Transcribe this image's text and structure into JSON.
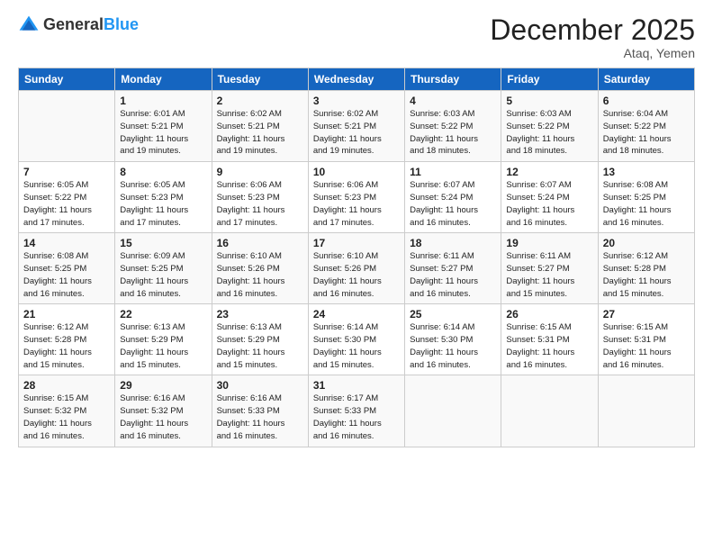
{
  "logo": {
    "general": "General",
    "blue": "Blue"
  },
  "title": "December 2025",
  "location": "Ataq, Yemen",
  "weekdays": [
    "Sunday",
    "Monday",
    "Tuesday",
    "Wednesday",
    "Thursday",
    "Friday",
    "Saturday"
  ],
  "weeks": [
    [
      {
        "num": "",
        "info": ""
      },
      {
        "num": "1",
        "info": "Sunrise: 6:01 AM\nSunset: 5:21 PM\nDaylight: 11 hours\nand 19 minutes."
      },
      {
        "num": "2",
        "info": "Sunrise: 6:02 AM\nSunset: 5:21 PM\nDaylight: 11 hours\nand 19 minutes."
      },
      {
        "num": "3",
        "info": "Sunrise: 6:02 AM\nSunset: 5:21 PM\nDaylight: 11 hours\nand 19 minutes."
      },
      {
        "num": "4",
        "info": "Sunrise: 6:03 AM\nSunset: 5:22 PM\nDaylight: 11 hours\nand 18 minutes."
      },
      {
        "num": "5",
        "info": "Sunrise: 6:03 AM\nSunset: 5:22 PM\nDaylight: 11 hours\nand 18 minutes."
      },
      {
        "num": "6",
        "info": "Sunrise: 6:04 AM\nSunset: 5:22 PM\nDaylight: 11 hours\nand 18 minutes."
      }
    ],
    [
      {
        "num": "7",
        "info": "Sunrise: 6:05 AM\nSunset: 5:22 PM\nDaylight: 11 hours\nand 17 minutes."
      },
      {
        "num": "8",
        "info": "Sunrise: 6:05 AM\nSunset: 5:23 PM\nDaylight: 11 hours\nand 17 minutes."
      },
      {
        "num": "9",
        "info": "Sunrise: 6:06 AM\nSunset: 5:23 PM\nDaylight: 11 hours\nand 17 minutes."
      },
      {
        "num": "10",
        "info": "Sunrise: 6:06 AM\nSunset: 5:23 PM\nDaylight: 11 hours\nand 17 minutes."
      },
      {
        "num": "11",
        "info": "Sunrise: 6:07 AM\nSunset: 5:24 PM\nDaylight: 11 hours\nand 16 minutes."
      },
      {
        "num": "12",
        "info": "Sunrise: 6:07 AM\nSunset: 5:24 PM\nDaylight: 11 hours\nand 16 minutes."
      },
      {
        "num": "13",
        "info": "Sunrise: 6:08 AM\nSunset: 5:25 PM\nDaylight: 11 hours\nand 16 minutes."
      }
    ],
    [
      {
        "num": "14",
        "info": "Sunrise: 6:08 AM\nSunset: 5:25 PM\nDaylight: 11 hours\nand 16 minutes."
      },
      {
        "num": "15",
        "info": "Sunrise: 6:09 AM\nSunset: 5:25 PM\nDaylight: 11 hours\nand 16 minutes."
      },
      {
        "num": "16",
        "info": "Sunrise: 6:10 AM\nSunset: 5:26 PM\nDaylight: 11 hours\nand 16 minutes."
      },
      {
        "num": "17",
        "info": "Sunrise: 6:10 AM\nSunset: 5:26 PM\nDaylight: 11 hours\nand 16 minutes."
      },
      {
        "num": "18",
        "info": "Sunrise: 6:11 AM\nSunset: 5:27 PM\nDaylight: 11 hours\nand 16 minutes."
      },
      {
        "num": "19",
        "info": "Sunrise: 6:11 AM\nSunset: 5:27 PM\nDaylight: 11 hours\nand 15 minutes."
      },
      {
        "num": "20",
        "info": "Sunrise: 6:12 AM\nSunset: 5:28 PM\nDaylight: 11 hours\nand 15 minutes."
      }
    ],
    [
      {
        "num": "21",
        "info": "Sunrise: 6:12 AM\nSunset: 5:28 PM\nDaylight: 11 hours\nand 15 minutes."
      },
      {
        "num": "22",
        "info": "Sunrise: 6:13 AM\nSunset: 5:29 PM\nDaylight: 11 hours\nand 15 minutes."
      },
      {
        "num": "23",
        "info": "Sunrise: 6:13 AM\nSunset: 5:29 PM\nDaylight: 11 hours\nand 15 minutes."
      },
      {
        "num": "24",
        "info": "Sunrise: 6:14 AM\nSunset: 5:30 PM\nDaylight: 11 hours\nand 15 minutes."
      },
      {
        "num": "25",
        "info": "Sunrise: 6:14 AM\nSunset: 5:30 PM\nDaylight: 11 hours\nand 16 minutes."
      },
      {
        "num": "26",
        "info": "Sunrise: 6:15 AM\nSunset: 5:31 PM\nDaylight: 11 hours\nand 16 minutes."
      },
      {
        "num": "27",
        "info": "Sunrise: 6:15 AM\nSunset: 5:31 PM\nDaylight: 11 hours\nand 16 minutes."
      }
    ],
    [
      {
        "num": "28",
        "info": "Sunrise: 6:15 AM\nSunset: 5:32 PM\nDaylight: 11 hours\nand 16 minutes."
      },
      {
        "num": "29",
        "info": "Sunrise: 6:16 AM\nSunset: 5:32 PM\nDaylight: 11 hours\nand 16 minutes."
      },
      {
        "num": "30",
        "info": "Sunrise: 6:16 AM\nSunset: 5:33 PM\nDaylight: 11 hours\nand 16 minutes."
      },
      {
        "num": "31",
        "info": "Sunrise: 6:17 AM\nSunset: 5:33 PM\nDaylight: 11 hours\nand 16 minutes."
      },
      {
        "num": "",
        "info": ""
      },
      {
        "num": "",
        "info": ""
      },
      {
        "num": "",
        "info": ""
      }
    ]
  ]
}
